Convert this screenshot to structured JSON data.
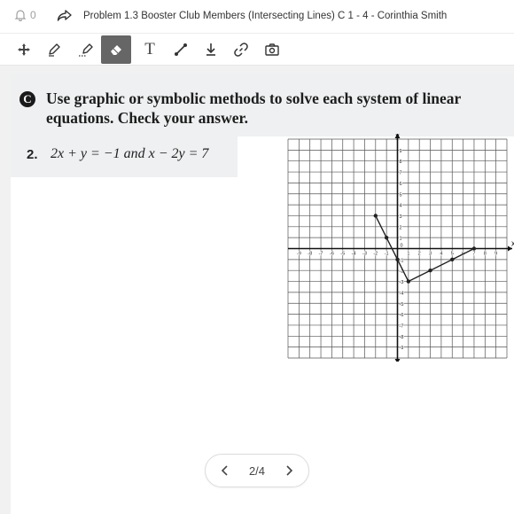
{
  "header": {
    "notification_count": "0",
    "title": "Problem 1.3 Booster Club Members (Intersecting Lines) C 1 - 4 - Corinthia Smith"
  },
  "toolbar": {
    "tools": [
      "move-icon",
      "pen-icon",
      "highlighter-icon",
      "eraser-icon",
      "text-icon",
      "line-icon",
      "pin-icon",
      "link-icon",
      "camera-icon"
    ],
    "active_tool": "eraser-icon",
    "text_tool_label": "T"
  },
  "worksheet": {
    "section_letter": "C",
    "instructions": "Use graphic or symbolic methods to solve each system of linear equations. Check your answer.",
    "question_number": "2.",
    "question_text": "2x + y = −1 and x − 2y = 7"
  },
  "graph": {
    "x_axis_label": "x",
    "y_axis_label": "y",
    "origin_label": "0",
    "x_range": [
      -9,
      9
    ],
    "y_range": [
      -9,
      9
    ],
    "x_tick_labels": [
      "-9",
      "-8",
      "-7",
      "-6",
      "-5",
      "-4",
      "-3",
      "-2",
      "-1",
      "1",
      "2",
      "3",
      "4",
      "5",
      "6",
      "7",
      "8",
      "9"
    ],
    "y_tick_labels": [
      "9",
      "8",
      "7",
      "6",
      "5",
      "4",
      "3",
      "2",
      "1",
      "-1",
      "-2",
      "-3",
      "-4",
      "-5",
      "-6",
      "-7",
      "-8",
      "-9"
    ],
    "drawn_points": [
      [
        -2,
        3
      ],
      [
        -1,
        1
      ],
      [
        0,
        -1
      ],
      [
        1,
        -3
      ],
      [
        3,
        -2
      ],
      [
        5,
        -1
      ],
      [
        7,
        0
      ]
    ],
    "drawn_path": [
      [
        -2,
        3
      ],
      [
        -1,
        1
      ],
      [
        0,
        -1
      ],
      [
        1,
        -3
      ],
      [
        3,
        -2
      ],
      [
        5,
        -1
      ],
      [
        7,
        0
      ]
    ]
  },
  "pager": {
    "label": "2/4"
  }
}
